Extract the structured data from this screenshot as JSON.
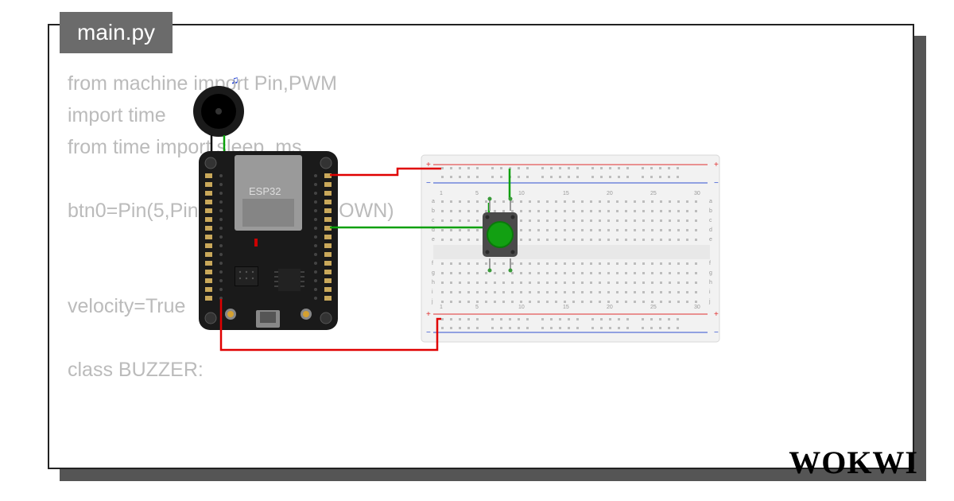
{
  "tab": {
    "filename": "main.py"
  },
  "code": {
    "line1": "from machine import Pin,PWM",
    "line2": "import time",
    "line3": "from time import sleep_ms",
    "line4": "",
    "line5": "btn0=Pin(5,Pin.IN,Pin.PULL_DOWN)",
    "line6": "",
    "line7": "",
    "line8": "velocity=True",
    "line9": "",
    "line10": "class BUZZER:"
  },
  "board": {
    "chip_label": "ESP32"
  },
  "breadboard": {
    "top_numbers": [
      "1",
      "5",
      "10",
      "15",
      "20",
      "25",
      "30"
    ],
    "bottom_numbers": [
      "1",
      "5",
      "10",
      "15",
      "20",
      "25",
      "30"
    ],
    "rows_top": [
      "a",
      "b",
      "c",
      "d",
      "e"
    ],
    "rows_bottom": [
      "f",
      "g",
      "h",
      "i",
      "j"
    ]
  },
  "components": {
    "buzzer": "buzzer",
    "button": "push-button-green",
    "music_note": "♫"
  },
  "brand": "WOKWI",
  "wires": {
    "w1_color": "#0a0a0a",
    "w2_color": "#0aa00a",
    "w3_color": "#e00000",
    "w4_color": "#e00000",
    "w5_color": "#0aa00a",
    "w6_color": "#0aa00a"
  }
}
